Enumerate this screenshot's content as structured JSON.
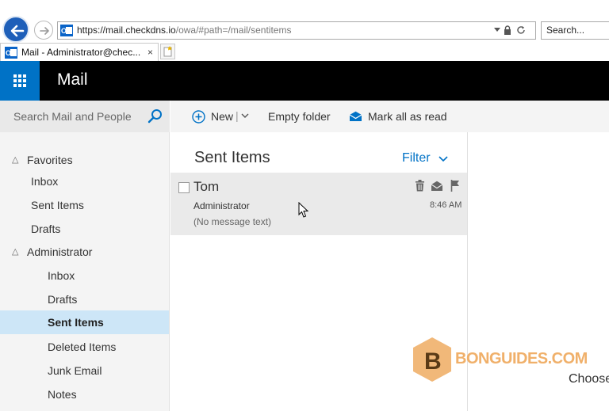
{
  "browser": {
    "url_main": "https://mail.checkdns.io",
    "url_rest": "/owa/#path=/mail/sentitems",
    "search_placeholder": "Search...",
    "tab_title": "Mail - Administrator@chec...",
    "tab_close": "×"
  },
  "header": {
    "app_title": "Mail"
  },
  "search": {
    "placeholder": "Search Mail and People"
  },
  "nav": {
    "favorites_label": "Favorites",
    "favorites": [
      {
        "label": "Inbox"
      },
      {
        "label": "Sent Items"
      },
      {
        "label": "Drafts"
      }
    ],
    "account_label": "Administrator",
    "folders": [
      {
        "label": "Inbox",
        "selected": false
      },
      {
        "label": "Drafts",
        "selected": false
      },
      {
        "label": "Sent Items",
        "selected": true
      },
      {
        "label": "Deleted Items",
        "selected": false
      },
      {
        "label": "Junk Email",
        "selected": false
      },
      {
        "label": "Notes",
        "selected": false
      }
    ]
  },
  "toolbar": {
    "new_label": "New",
    "separator": "|",
    "empty_folder_label": "Empty folder",
    "mark_all_read_label": "Mark all as read"
  },
  "message_list": {
    "title": "Sent Items",
    "filter_label": "Filter",
    "messages": [
      {
        "to": "Tom",
        "from": "Administrator",
        "preview": "(No message text)",
        "time": "8:46 AM"
      }
    ]
  },
  "reading_pane": {
    "hint": "Choose"
  },
  "watermark": {
    "text": "BONGUIDES.COM",
    "letter": "B"
  },
  "colors": {
    "accent": "#0072c6",
    "header_bg": "#000000",
    "selected_bg": "#cde6f7",
    "watermark": "#f0b06a"
  }
}
